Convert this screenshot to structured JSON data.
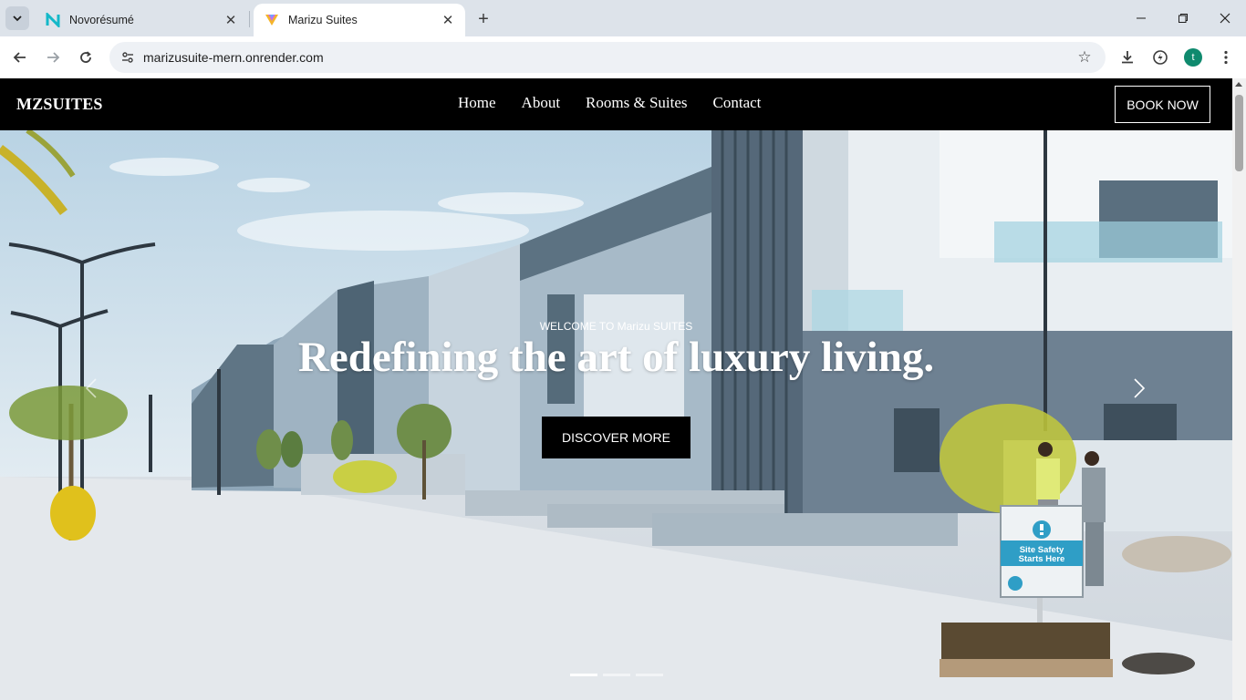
{
  "browser": {
    "tabs": [
      {
        "title": "Novorésumé",
        "icon": "novoresume-logo-icon",
        "active": false
      },
      {
        "title": "Marizu Suites",
        "icon": "marizu-logo-icon",
        "active": true
      }
    ],
    "url": "marizusuite-mern.onrender.com",
    "profile_initial": "t"
  },
  "site": {
    "brand": "MZSUITES",
    "nav": [
      "Home",
      "About",
      "Rooms & Suites",
      "Contact"
    ],
    "book_label": "BOOK NOW"
  },
  "hero": {
    "eyebrow": "WELCOME TO Marizu SUITES",
    "title": "Redefining the art of luxury living.",
    "cta": "DISCOVER MORE",
    "slides_total": 3,
    "slide_active": 1
  },
  "photo_sign": {
    "line1": "Site Safety",
    "line2": "Starts Here"
  },
  "colors": {
    "nav_bg": "#000000",
    "cta_bg": "#000000",
    "profile_bg": "#0f8a6e"
  }
}
